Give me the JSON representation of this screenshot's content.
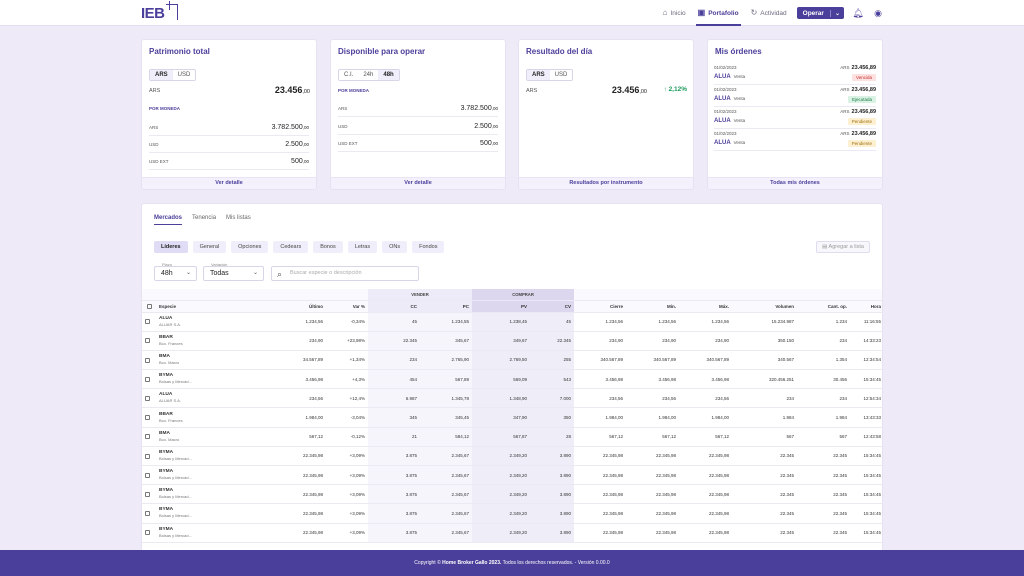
{
  "header": {
    "logo": "IEB",
    "nav": [
      {
        "label": "Inicio",
        "icon": "home-icon"
      },
      {
        "label": "Portafolio",
        "icon": "briefcase-icon"
      },
      {
        "label": "Actividad",
        "icon": "activity-icon"
      }
    ],
    "operar_label": "Operar"
  },
  "patrimonio": {
    "title": "Patrimonio total",
    "toggle": [
      "ARS",
      "USD"
    ],
    "currency": "ARS",
    "total": "23.456",
    "total_cents": ",00",
    "sub": "POR MONEDA",
    "rows": [
      {
        "k": "ARS",
        "v": "3.782.500",
        "c": ",00"
      },
      {
        "k": "USD",
        "v": "2.500",
        "c": ",00"
      },
      {
        "k": "USD EXT",
        "v": "500",
        "c": ",00"
      }
    ],
    "footer": "Ver detalle"
  },
  "disponible": {
    "title": "Disponible para operar",
    "toggle": [
      "C.I.",
      "24h",
      "48h"
    ],
    "sub": "POR MONEDA",
    "rows": [
      {
        "k": "ARS",
        "v": "3.782.500",
        "c": ",00"
      },
      {
        "k": "USD",
        "v": "2.500",
        "c": ",00"
      },
      {
        "k": "USD EXT",
        "v": "500",
        "c": ",00"
      }
    ],
    "footer": "Ver detalle"
  },
  "resultado": {
    "title": "Resultado del día",
    "toggle": [
      "ARS",
      "USD"
    ],
    "currency": "ARS",
    "total": "23.456",
    "total_cents": ",00",
    "pct": "2,12%",
    "footer": "Resultados por instrumento"
  },
  "ordenes": {
    "title": "Mis órdenes",
    "items": [
      {
        "date": "01/02/2023",
        "name": "ALUA",
        "type": "Venta",
        "cur": "ARS",
        "amount": "23.456,89",
        "status": "Vencida"
      },
      {
        "date": "01/02/2023",
        "name": "ALUA",
        "type": "Venta",
        "cur": "ARS",
        "amount": "23.456,89",
        "status": "Ejecutada"
      },
      {
        "date": "01/02/2023",
        "name": "ALUA",
        "type": "Venta",
        "cur": "ARS",
        "amount": "23.456,89",
        "status": "Pendiente"
      },
      {
        "date": "01/02/2023",
        "name": "ALUA",
        "type": "Venta",
        "cur": "ARS",
        "amount": "23.456,89",
        "status": "Pendiente"
      }
    ],
    "footer": "Todas mis órdenes"
  },
  "market": {
    "tabs": [
      "Mercados",
      "Tenencia",
      "Mis listas"
    ],
    "chips": [
      "Líderes",
      "General",
      "Opciones",
      "Cedears",
      "Bonos",
      "Letras",
      "ONs",
      "Fondos"
    ],
    "add_list": "Agregar a lista",
    "plazo_label": "Plazo",
    "plazo_value": "48h",
    "variacion_label": "Variación",
    "variacion_value": "Todas",
    "search_placeholder": "Buscar especie o descripción",
    "group_vender": "VENDER",
    "group_comprar": "COMPRAR",
    "columns": [
      "Especie",
      "Último",
      "Var %",
      "CC",
      "PC",
      "PV",
      "CV",
      "Cierre",
      "Mín.",
      "Máx.",
      "Volumen",
      "Cant. op.",
      "Hora"
    ],
    "rows": [
      {
        "sym": "ALUA",
        "desc": "ALUAR S.A.",
        "ult": "1.234,56",
        "var": "-0,34%",
        "cc": "45",
        "pc": "1.234,55",
        "pv": "1.238,45",
        "cv": "45",
        "cierre": "1.234,56",
        "min": "1.234,56",
        "max": "1.234,56",
        "vol": "15.234.987",
        "ops": "1.234",
        "hora": "11:16:55"
      },
      {
        "sym": "BBAR",
        "desc": "Bco. Frances",
        "ult": "234,90",
        "var": "+23,98%",
        "cc": "22.345",
        "pc": "345,67",
        "pv": "349,67",
        "cv": "22.345",
        "cierre": "234,90",
        "min": "234,90",
        "max": "234,90",
        "vol": "350.150",
        "ops": "234",
        "hora": "14:33:23"
      },
      {
        "sym": "BMA",
        "desc": "Bco. Macro",
        "ult": "34.567,89",
        "var": "+1,34%",
        "cc": "234",
        "pc": "2.765,90",
        "pv": "2.769,50",
        "cv": "255",
        "cierre": "340.567,89",
        "min": "340.567,89",
        "max": "340.567,89",
        "vol": "340.567",
        "ops": "1.354",
        "hora": "12:34:54"
      },
      {
        "sym": "BYMA",
        "desc": "Bolsas y Mercad...",
        "ult": "3.456,98",
        "var": "+4,3%",
        "cc": "454",
        "pc": "567,89",
        "pv": "569,09",
        "cv": "543",
        "cierre": "3.456,98",
        "min": "3.456,98",
        "max": "3.456,98",
        "vol": "320.456.251",
        "ops": "30.456",
        "hora": "15:34:45"
      },
      {
        "sym": "ALUA",
        "desc": "ALUAR S.A.",
        "ult": "234,56",
        "var": "+12,4%",
        "cc": "6.987",
        "pc": "1.345,78",
        "pv": "1.348,90",
        "cv": "7.000",
        "cierre": "234,56",
        "min": "234,56",
        "max": "234,56",
        "vol": "234",
        "ops": "234",
        "hora": "12:54:34"
      },
      {
        "sym": "BBAR",
        "desc": "Bco. Frances",
        "ult": "1.984,00",
        "var": "-3,04%",
        "cc": "345",
        "pc": "345,45",
        "pv": "347,90",
        "cv": "350",
        "cierre": "1.984,00",
        "min": "1.984,00",
        "max": "1.984,00",
        "vol": "1.984",
        "ops": "1.984",
        "hora": "13:43:33"
      },
      {
        "sym": "BMA",
        "desc": "Bco. Macro",
        "ult": "567,12",
        "var": "-0,12%",
        "cc": "21",
        "pc": "584,12",
        "pv": "567,87",
        "cv": "28",
        "cierre": "567,12",
        "min": "567,12",
        "max": "567,12",
        "vol": "567",
        "ops": "567",
        "hora": "12:43:58"
      },
      {
        "sym": "BYMA",
        "desc": "Bolsas y Mercad...",
        "ult": "22.345,98",
        "var": "+3,09%",
        "cc": "3.875",
        "pc": "2.345,67",
        "pv": "2.349,20",
        "cv": "3.890",
        "cierre": "22.345,98",
        "min": "22.345,98",
        "max": "22.345,98",
        "vol": "22.345",
        "ops": "22.345",
        "hora": "15:34:45"
      },
      {
        "sym": "BYMA",
        "desc": "Bolsas y Mercad...",
        "ult": "22.345,98",
        "var": "+3,09%",
        "cc": "3.875",
        "pc": "2.345,67",
        "pv": "2.349,20",
        "cv": "3.890",
        "cierre": "22.345,98",
        "min": "22.345,98",
        "max": "22.345,98",
        "vol": "22.345",
        "ops": "22.345",
        "hora": "15:34:45"
      },
      {
        "sym": "BYMA",
        "desc": "Bolsas y Mercad...",
        "ult": "22.345,98",
        "var": "+3,09%",
        "cc": "3.875",
        "pc": "2.345,67",
        "pv": "2.349,20",
        "cv": "3.890",
        "cierre": "22.345,98",
        "min": "22.345,98",
        "max": "22.345,98",
        "vol": "22.345",
        "ops": "22.345",
        "hora": "15:34:45"
      },
      {
        "sym": "BYMA",
        "desc": "Bolsas y Mercad...",
        "ult": "22.345,98",
        "var": "+3,09%",
        "cc": "3.875",
        "pc": "2.345,67",
        "pv": "2.349,20",
        "cv": "3.890",
        "cierre": "22.345,98",
        "min": "22.345,98",
        "max": "22.345,98",
        "vol": "22.345",
        "ops": "22.345",
        "hora": "15:34:45"
      },
      {
        "sym": "BYMA",
        "desc": "Bolsas y Mercad...",
        "ult": "22.345,98",
        "var": "+3,09%",
        "cc": "3.875",
        "pc": "2.345,67",
        "pv": "2.349,20",
        "cv": "3.890",
        "cierre": "22.345,98",
        "min": "22.345,98",
        "max": "22.345,98",
        "vol": "22.345",
        "ops": "22.345",
        "hora": "15:34:45"
      }
    ]
  },
  "footer": {
    "prefix": "Copyright © ",
    "brand": "Home Broker Gallo 2023.",
    "suffix": " Todos los derechos reservados. - Versión 0.00.0"
  }
}
